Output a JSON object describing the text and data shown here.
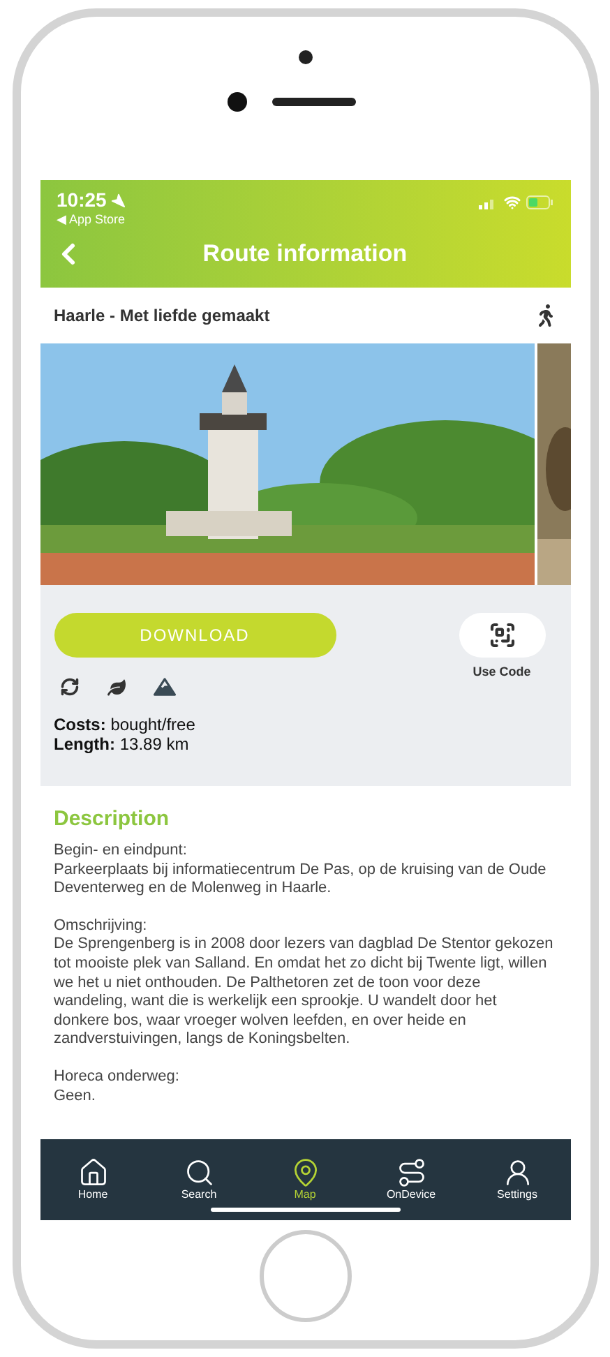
{
  "status_bar": {
    "time": "10:25",
    "back_app": "◀ App Store"
  },
  "nav": {
    "title": "Route information"
  },
  "route": {
    "name": "Haarle - Met liefde gemaakt"
  },
  "actions": {
    "download": "DOWNLOAD",
    "use_code": "Use Code"
  },
  "facts": [
    {
      "label": "Costs:",
      "value": "bought/free"
    },
    {
      "label": "Length:",
      "value": "13.89 km"
    }
  ],
  "description": {
    "title": "Description",
    "paragraphs": [
      "Begin- en eindpunt:\nParkeerplaats bij informatiecentrum De Pas, op de kruising van de Oude Deventerweg en de Molenweg in Haarle.",
      "Omschrijving:\nDe Sprengenberg is in 2008 door lezers van dagblad De Stentor gekozen tot mooiste plek van Salland. En omdat het zo dicht bij Twente ligt, willen we het u niet onthouden. De Palthetoren zet de toon voor deze wandeling, want die is werkelijk een sprookje. U wandelt door het donkere bos, waar vroeger wolven leefden, en over heide en zandverstuivingen, langs de Koningsbelten.",
      "Horeca onderweg:\nGeen."
    ]
  },
  "tab_bar": [
    {
      "label": "Home",
      "selected": false
    },
    {
      "label": "Search",
      "selected": false
    },
    {
      "label": "Map",
      "selected": true
    },
    {
      "label": "OnDevice",
      "selected": false
    },
    {
      "label": "Settings",
      "selected": false
    }
  ]
}
